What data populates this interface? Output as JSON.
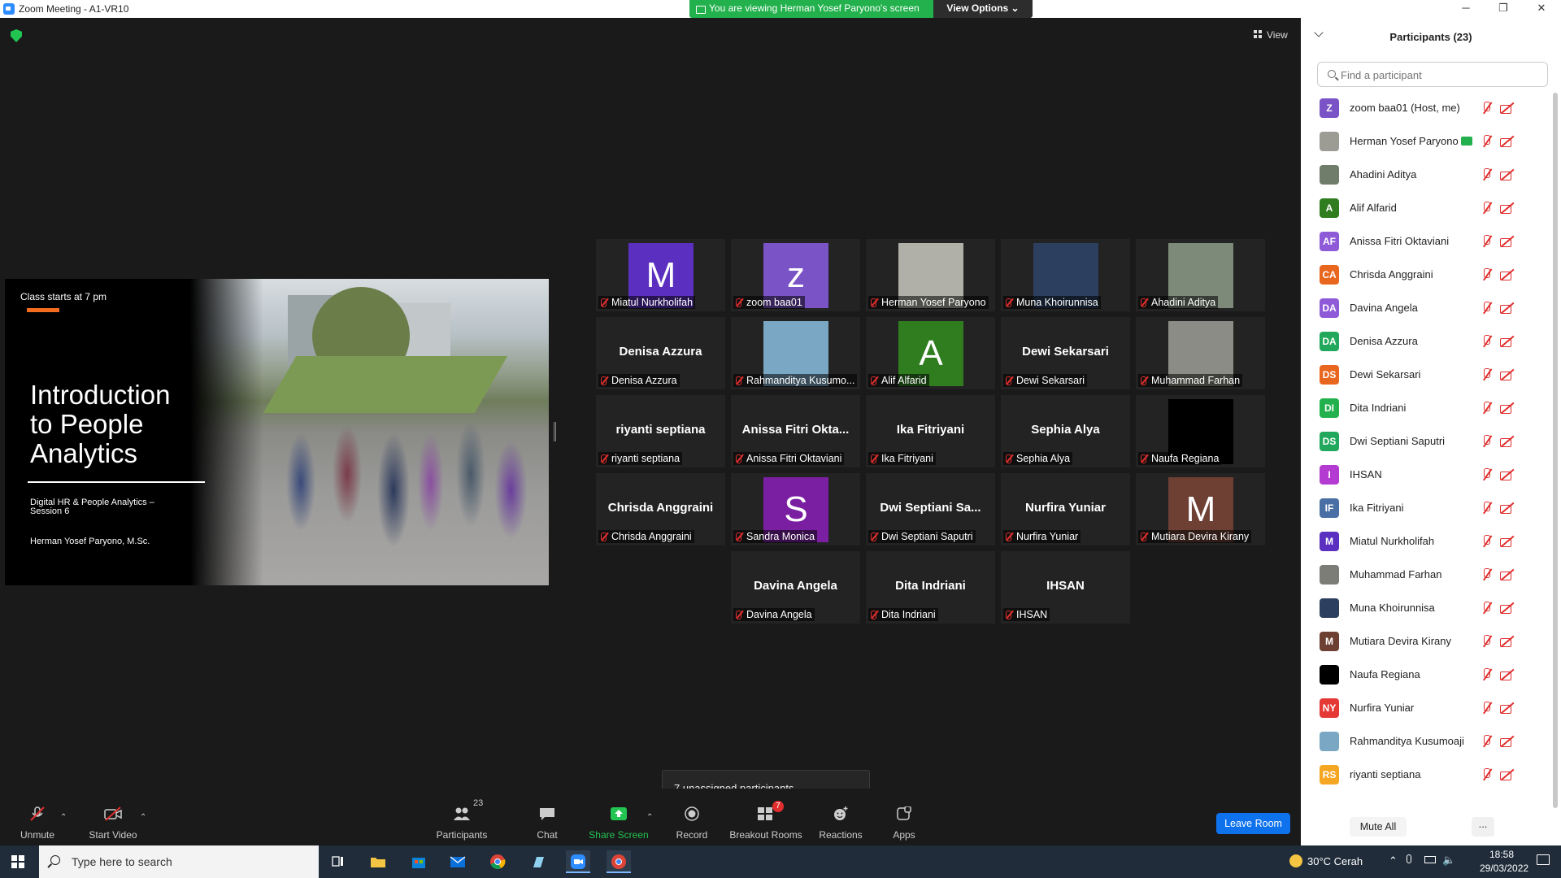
{
  "window": {
    "title": "Zoom Meeting - A1-VR10",
    "minimize": "─",
    "maximize": "❐",
    "close": "✕"
  },
  "banner": {
    "viewing": "You are viewing Herman Yosef Paryono's screen",
    "view_options": "View Options ⌄"
  },
  "view_button": "View",
  "slide": {
    "class_starts": "Class starts at 7 pm",
    "title": "Introduction to People Analytics",
    "subtitle": "Digital HR & People Analytics – Session 6",
    "presenter": "Herman Yosef Paryono, M.Sc."
  },
  "gallery": [
    {
      "big": "",
      "label": "Miatul Nurkholifah",
      "avatar": "M",
      "bg": "#5b2fbf"
    },
    {
      "big": "",
      "label": "zoom baa01",
      "avatar": "z",
      "bg": "#7a53c6"
    },
    {
      "big": "",
      "label": "Herman Yosef Paryono",
      "avatar": "",
      "bg": "#b0b0a8"
    },
    {
      "big": "",
      "label": "Muna Khoirunnisa",
      "avatar": "",
      "bg": "#2c3f5e"
    },
    {
      "big": "",
      "label": "Ahadini Aditya",
      "avatar": "",
      "bg": "#7d8a7a"
    },
    {
      "big": "Denisa Azzura",
      "label": "Denisa Azzura",
      "avatar": "",
      "bg": ""
    },
    {
      "big": "",
      "label": "Rahmanditya Kusumo...",
      "avatar": "",
      "bg": "#7aa8c4"
    },
    {
      "big": "",
      "label": "Alif Alfarid",
      "avatar": "A",
      "bg": "#2f7d1f"
    },
    {
      "big": "Dewi Sekarsari",
      "label": "Dewi Sekarsari",
      "avatar": "",
      "bg": ""
    },
    {
      "big": "",
      "label": "Muhammad Farhan",
      "avatar": "",
      "bg": "#8c8c86"
    },
    {
      "big": "riyanti septiana",
      "label": "riyanti septiana",
      "avatar": "",
      "bg": ""
    },
    {
      "big": "Anissa Fitri Okta...",
      "label": "Anissa Fitri Oktaviani",
      "avatar": "",
      "bg": ""
    },
    {
      "big": "Ika Fitriyani",
      "label": "Ika Fitriyani",
      "avatar": "",
      "bg": ""
    },
    {
      "big": "Sephia Alya",
      "label": "Sephia Alya",
      "avatar": "",
      "bg": ""
    },
    {
      "big": "",
      "label": "Naufa Regiana",
      "avatar": "",
      "bg": "#000000"
    },
    {
      "big": "Chrisda Anggraini",
      "label": "Chrisda Anggraini",
      "avatar": "",
      "bg": ""
    },
    {
      "big": "",
      "label": "Sandra Monica",
      "avatar": "S",
      "bg": "#7b1fa2"
    },
    {
      "big": "Dwi Septiani Sa...",
      "label": "Dwi Septiani Saputri",
      "avatar": "",
      "bg": ""
    },
    {
      "big": "Nurfira Yuniar",
      "label": "Nurfira Yuniar",
      "avatar": "",
      "bg": ""
    },
    {
      "big": "",
      "label": "Mutiara Devira Kirany",
      "avatar": "M",
      "bg": "#6d4033"
    },
    {
      "big": "Davina Angela",
      "label": "Davina Angela",
      "avatar": "",
      "bg": ""
    },
    {
      "big": "Dita Indriani",
      "label": "Dita Indriani",
      "avatar": "",
      "bg": ""
    },
    {
      "big": "IHSAN",
      "label": "IHSAN",
      "avatar": "",
      "bg": ""
    }
  ],
  "unassigned": "7 unassigned participants",
  "toolbar": {
    "unmute": "Unmute",
    "start_video": "Start Video",
    "participants": "Participants",
    "participants_count": "23",
    "chat": "Chat",
    "share_screen": "Share Screen",
    "record": "Record",
    "breakout_rooms": "Breakout Rooms",
    "breakout_badge": "7",
    "reactions": "Reactions",
    "apps": "Apps",
    "leave_room": "Leave Room"
  },
  "panel": {
    "title": "Participants (23)",
    "search_placeholder": "Find a participant",
    "mute_all": "Mute All",
    "more": "...",
    "participants": [
      {
        "initials": "Z",
        "name": "zoom baa01 (Host, me)",
        "color": "#7a53c6",
        "share": false
      },
      {
        "initials": "",
        "name": "Herman Yosef Paryono",
        "color": "#9c9c94",
        "share": true
      },
      {
        "initials": "",
        "name": "Ahadini Aditya",
        "color": "#6f7d6a",
        "share": false
      },
      {
        "initials": "A",
        "name": "Alif Alfarid",
        "color": "#2f7d1f",
        "share": false
      },
      {
        "initials": "AF",
        "name": "Anissa Fitri Oktaviani",
        "color": "#8e5ad8",
        "share": false
      },
      {
        "initials": "CA",
        "name": "Chrisda Anggraini",
        "color": "#e8661e",
        "share": false
      },
      {
        "initials": "DA",
        "name": "Davina Angela",
        "color": "#8e5ad8",
        "share": false
      },
      {
        "initials": "DA",
        "name": "Denisa Azzura",
        "color": "#22a85c",
        "share": false
      },
      {
        "initials": "DS",
        "name": "Dewi Sekarsari",
        "color": "#e8661e",
        "share": false
      },
      {
        "initials": "DI",
        "name": "Dita Indriani",
        "color": "#22b14c",
        "share": false
      },
      {
        "initials": "DS",
        "name": "Dwi Septiani Saputri",
        "color": "#22a85c",
        "share": false
      },
      {
        "initials": "I",
        "name": "IHSAN",
        "color": "#b43bd1",
        "share": false
      },
      {
        "initials": "IF",
        "name": "Ika Fitriyani",
        "color": "#4a6fa5",
        "share": false
      },
      {
        "initials": "M",
        "name": "Miatul Nurkholifah",
        "color": "#5b2fbf",
        "share": false
      },
      {
        "initials": "",
        "name": "Muhammad Farhan",
        "color": "#7d7d78",
        "share": false
      },
      {
        "initials": "",
        "name": "Muna Khoirunnisa",
        "color": "#2c3f5e",
        "share": false
      },
      {
        "initials": "M",
        "name": "Mutiara Devira Kirany",
        "color": "#6d4033",
        "share": false
      },
      {
        "initials": "",
        "name": "Naufa Regiana",
        "color": "#000000",
        "share": false
      },
      {
        "initials": "NY",
        "name": "Nurfira Yuniar",
        "color": "#e53935",
        "share": false
      },
      {
        "initials": "",
        "name": "Rahmanditya Kusumoaji",
        "color": "#7aa8c4",
        "share": false
      },
      {
        "initials": "RS",
        "name": "riyanti septiana",
        "color": "#f5a623",
        "share": false
      }
    ]
  },
  "taskbar": {
    "search": "Type here to search",
    "weather": "30°C  Cerah",
    "time": "18:58",
    "date": "29/03/2022"
  }
}
